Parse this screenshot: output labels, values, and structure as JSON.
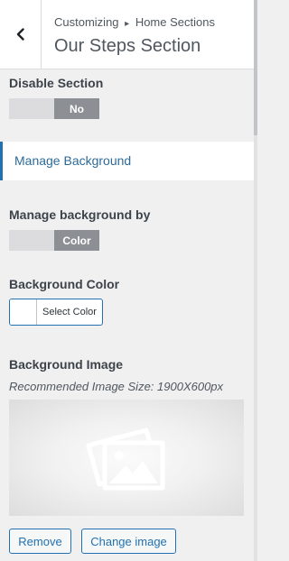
{
  "header": {
    "breadcrumb_parent": "Customizing",
    "breadcrumb_separator": "▸",
    "breadcrumb_current": "Home Sections",
    "title": "Our Steps Section"
  },
  "disable_section": {
    "label": "Disable Section",
    "toggle_value": "No"
  },
  "manage_background_link": "Manage Background",
  "manage_background_by": {
    "label": "Manage background by",
    "toggle_value": "Color"
  },
  "background_color": {
    "label": "Background Color",
    "button_label": "Select Color",
    "swatch_color": "#ffffff"
  },
  "background_image": {
    "label": "Background Image",
    "description": "Recommended Image Size: 1900X600px",
    "placeholder_icon": "image-placeholder-icon",
    "remove_label": "Remove",
    "change_label": "Change image"
  },
  "colors": {
    "accent": "#2271b1",
    "toggle_on": "#8c8f94",
    "toggle_off": "#dcdcde",
    "panel_bg": "#f0f0f1"
  }
}
